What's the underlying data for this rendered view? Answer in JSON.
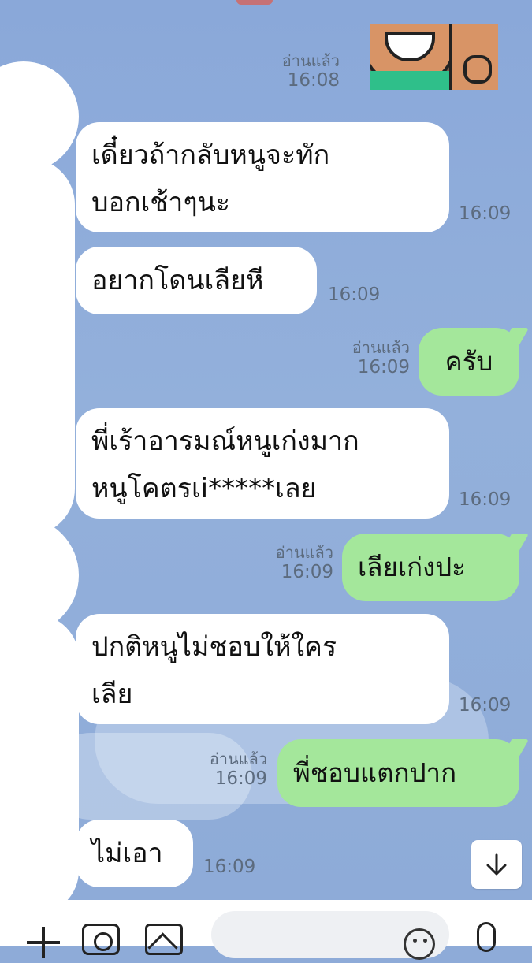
{
  "messages": [
    {
      "id": "m1",
      "direction": "out",
      "type": "sticker",
      "read_label": "อ่านแล้ว",
      "time": "16:08"
    },
    {
      "id": "m2",
      "direction": "in",
      "text": "เดี๋ยวถ้ากลับหนูจะทัก\nบอกเช้าๆนะ",
      "time": "16:09"
    },
    {
      "id": "m3",
      "direction": "in",
      "text": "อยากโดนเลียหี",
      "time": "16:09"
    },
    {
      "id": "m4",
      "direction": "out",
      "text": "ครับ",
      "read_label": "อ่านแล้ว",
      "time": "16:09"
    },
    {
      "id": "m5",
      "direction": "in",
      "text": "พี่เร้าอารมณ์หนูเก่งมาก\nหนูโคตรเi*****เลย",
      "time": "16:09"
    },
    {
      "id": "m6",
      "direction": "out",
      "text": "เลียเก่งปะ",
      "read_label": "อ่านแล้ว",
      "time": "16:09"
    },
    {
      "id": "m7",
      "direction": "in",
      "text": "ปกติหนูไม่ชอบให้ใคร\nเลีย",
      "time": "16:09"
    },
    {
      "id": "m8",
      "direction": "out",
      "text": "พี่ชอบแตกปาก",
      "read_label": "อ่านแล้ว",
      "time": "16:09"
    },
    {
      "id": "m9",
      "direction": "in",
      "text": "ไม่เอา",
      "time": "16:09"
    }
  ],
  "icons": {
    "scroll_down": "arrow-down-icon",
    "plus": "plus-icon",
    "camera": "camera-icon",
    "image": "image-icon",
    "emoji": "emoji-icon",
    "mic": "mic-icon"
  },
  "colors": {
    "chat_background": "#8eabd8",
    "incoming_bubble": "#ffffff",
    "outgoing_bubble": "#a4e79b",
    "meta_text": "#5c6b7e"
  }
}
